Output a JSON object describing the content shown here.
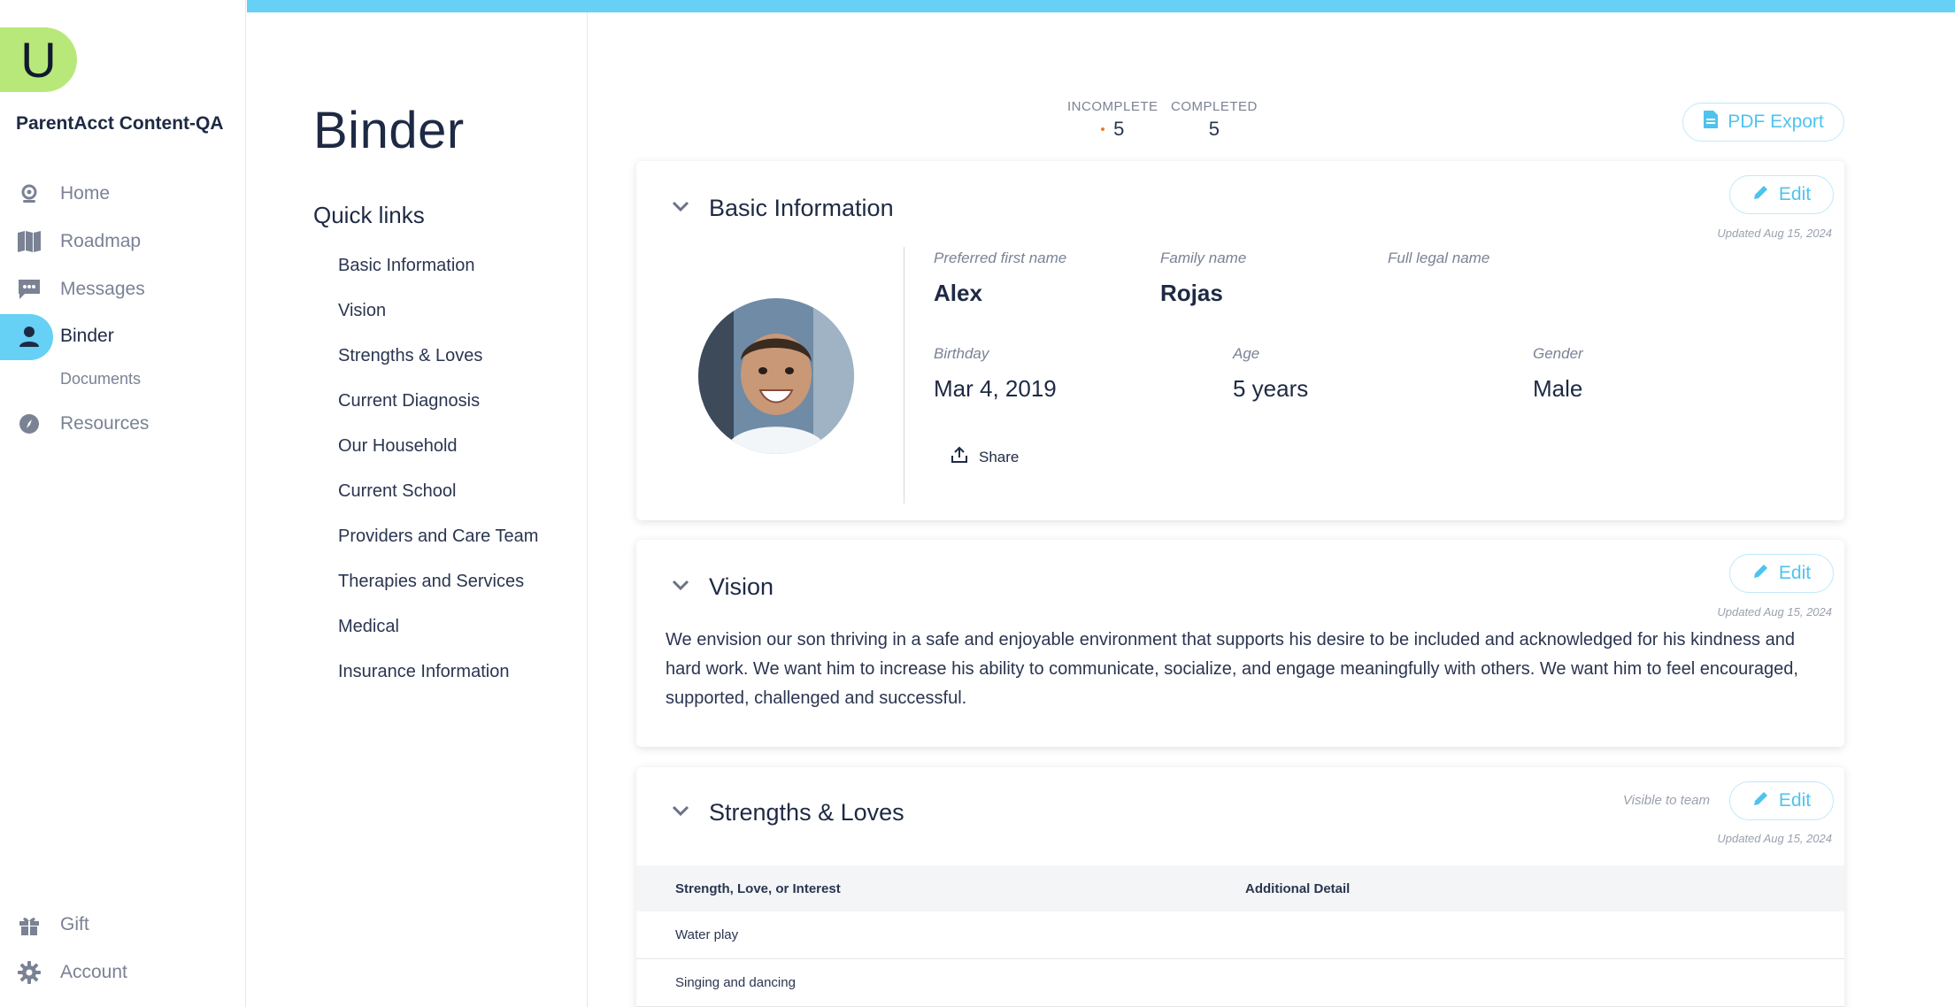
{
  "nav": {
    "logo_letter": "U",
    "account_name": "ParentAcct Content-QA",
    "items": [
      {
        "label": "Home",
        "icon": "home-icon"
      },
      {
        "label": "Roadmap",
        "icon": "map-icon"
      },
      {
        "label": "Messages",
        "icon": "chat-icon"
      },
      {
        "label": "Binder",
        "icon": "person-icon",
        "active": true
      },
      {
        "label": "Resources",
        "icon": "compass-icon"
      }
    ],
    "sub_item": "Documents",
    "bottom_items": [
      {
        "label": "Gift",
        "icon": "gift-icon"
      },
      {
        "label": "Account",
        "icon": "gear-icon"
      }
    ]
  },
  "page": {
    "title": "Binder",
    "quick_links_title": "Quick links",
    "quick_links": [
      "Basic Information",
      "Vision",
      "Strengths & Loves",
      "Current Diagnosis",
      "Our Household",
      "Current School",
      "Providers and Care Team",
      "Therapies and Services",
      "Medical",
      "Insurance Information"
    ]
  },
  "stats": {
    "incomplete_label": "INCOMPLETE",
    "incomplete_value": "5",
    "completed_label": "COMPLETED",
    "completed_value": "5"
  },
  "pdf_export_label": "PDF Export",
  "basic_info": {
    "title": "Basic Information",
    "edit_label": "Edit",
    "updated": "Updated Aug 15, 2024",
    "preferred_first_name_label": "Preferred first name",
    "preferred_first_name": "Alex",
    "family_name_label": "Family name",
    "family_name": "Rojas",
    "full_legal_name_label": "Full legal name",
    "full_legal_name": "",
    "birthday_label": "Birthday",
    "birthday": "Mar 4, 2019",
    "age_label": "Age",
    "age": "5 years",
    "gender_label": "Gender",
    "gender": "Male",
    "share_label": "Share"
  },
  "vision": {
    "title": "Vision",
    "edit_label": "Edit",
    "updated": "Updated Aug 15, 2024",
    "text": "We envision our son thriving in a safe and enjoyable environment that supports his desire to be included and acknowledged for his kindness and hard work. We want him to increase his ability to communicate, socialize, and engage meaningfully with others. We want him to feel encouraged, supported, challenged and successful."
  },
  "strengths": {
    "title": "Strengths & Loves",
    "visible_label": "Visible to team",
    "edit_label": "Edit",
    "updated": "Updated Aug 15, 2024",
    "columns": [
      "Strength, Love, or Interest",
      "Additional Detail"
    ],
    "rows": [
      {
        "item": "Water play",
        "detail": ""
      },
      {
        "item": "Singing and dancing",
        "detail": ""
      }
    ]
  },
  "colors": {
    "accent": "#66d0f5",
    "logo": "#b9e87a",
    "incomplete_dot": "#f07a2a"
  }
}
